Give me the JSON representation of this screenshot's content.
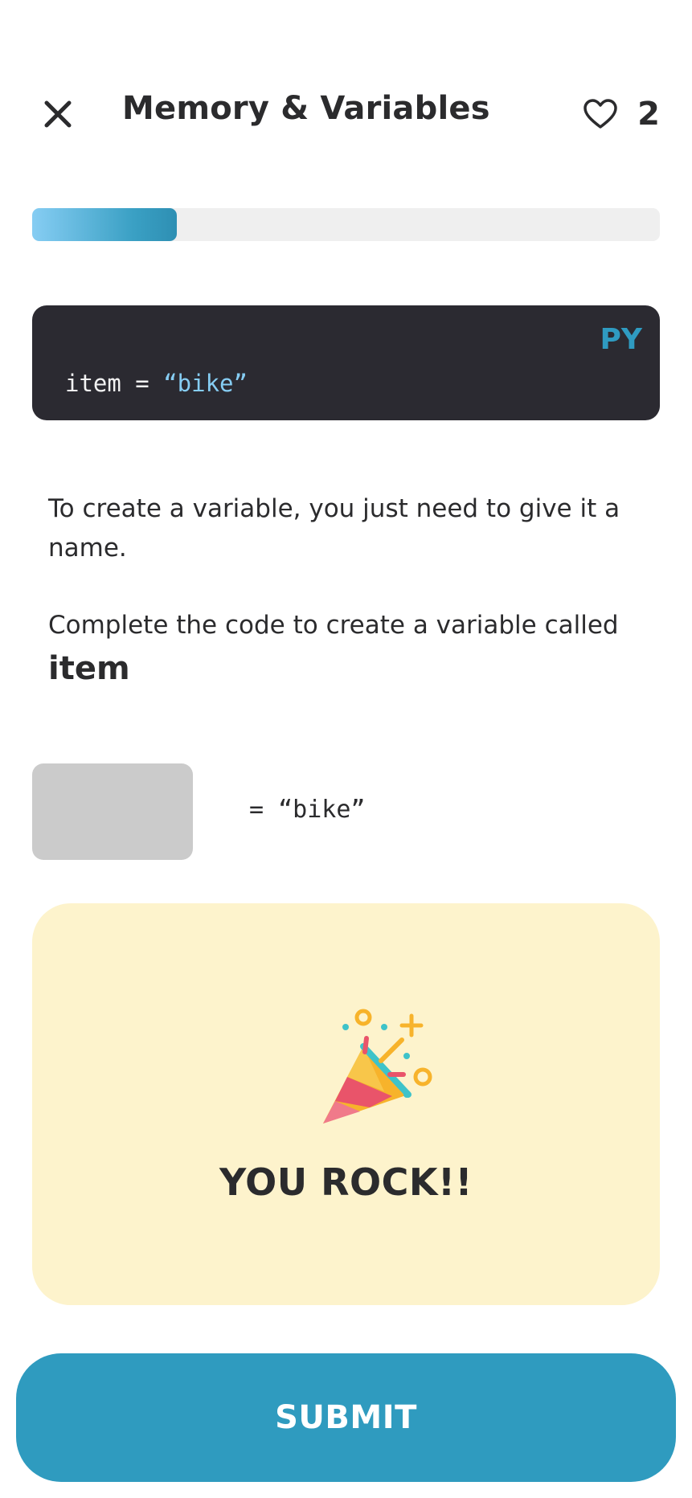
{
  "header": {
    "title": "Memory & Variables",
    "close_icon": "close-icon",
    "heart_icon": "heart-outline-icon",
    "lives_count": "2"
  },
  "progress": {
    "fraction": 0.23
  },
  "code_block": {
    "language": "PY",
    "line_prefix": "item = ",
    "line_string": "“bike”"
  },
  "instructions": {
    "text1": "To create a variable, you just need to give it a name.",
    "text2": "Complete the code to create a variable called",
    "keyword": "item"
  },
  "exercise": {
    "code_rest": "= “bike”"
  },
  "feedback": {
    "icon": "party-popper-icon",
    "message": "YOU ROCK!!"
  },
  "submit": {
    "label": "SUBMIT"
  },
  "colors": {
    "accent": "#2f9bbf",
    "feedback_bg": "#fdf3cc",
    "code_bg": "#2b2a31"
  }
}
